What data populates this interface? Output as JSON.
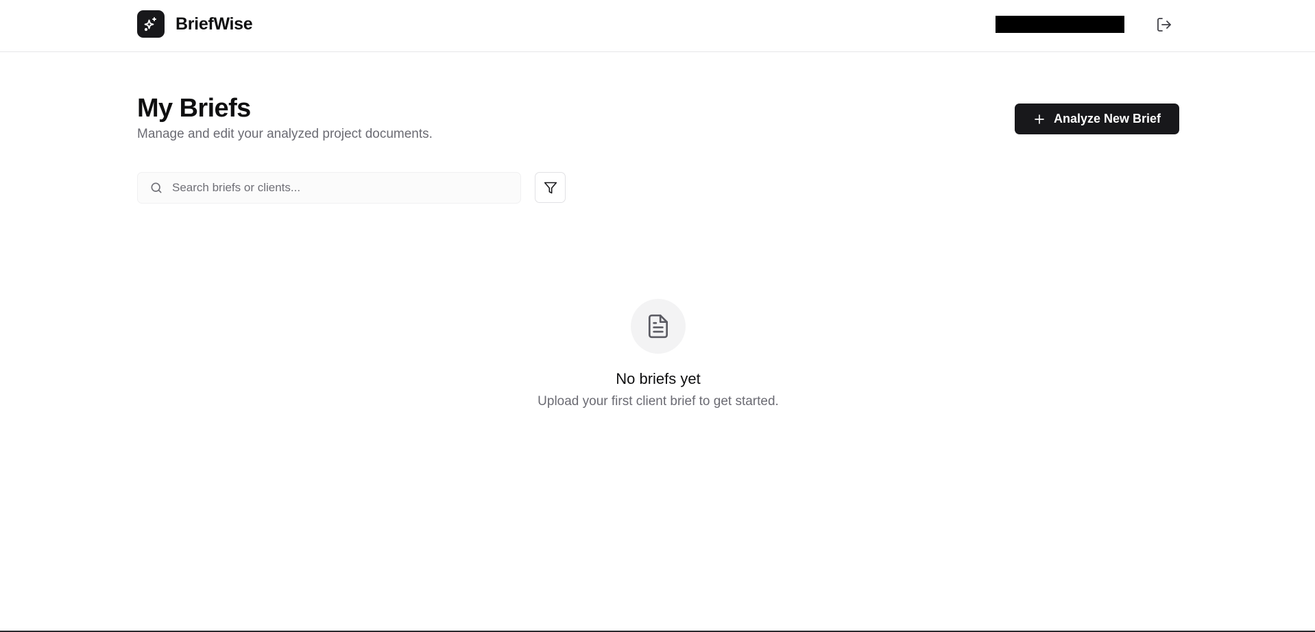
{
  "app": {
    "name": "BriefWise",
    "logo_icon": "sparkles-icon"
  },
  "header": {
    "logout_icon": "log-out-icon"
  },
  "page": {
    "title": "My Briefs",
    "subtitle": "Manage and edit your analyzed project documents.",
    "primary_action_label": "Analyze New Brief",
    "primary_action_icon": "plus-icon"
  },
  "search": {
    "placeholder": "Search briefs or clients...",
    "value": "",
    "icon": "search-icon"
  },
  "filter": {
    "icon": "filter-icon"
  },
  "empty_state": {
    "icon": "file-text-icon",
    "title": "No briefs yet",
    "message": "Upload your first client brief to get started."
  },
  "colors": {
    "primary": "#18181b",
    "muted_text": "#6b6b73",
    "border": "#e6e6e8",
    "empty_icon_bg": "#f3f3f4"
  }
}
